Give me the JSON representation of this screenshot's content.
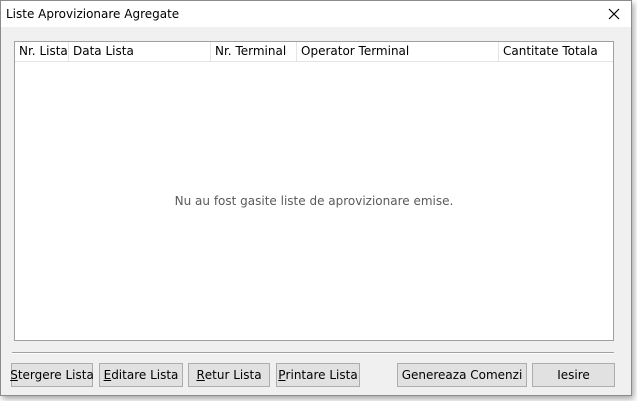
{
  "window": {
    "title": "Liste Aprovizionare Agregate"
  },
  "icons": {
    "close": "close-icon"
  },
  "list": {
    "columns": [
      "Nr. Lista",
      "Data Lista",
      "Nr. Terminal",
      "Operator Terminal",
      "Cantitate Totala"
    ],
    "empty_message": "Nu au fost gasite liste de aprovizionare emise."
  },
  "buttons": {
    "delete": {
      "accel": "S",
      "rest": "tergere Lista"
    },
    "edit": {
      "accel": "E",
      "rest": "ditare Lista"
    },
    "return": {
      "accel": "R",
      "rest": "etur Lista"
    },
    "print": {
      "accel": "P",
      "rest": "rintare Lista"
    },
    "generate": "Genereaza Comenzi",
    "exit": "Iesire"
  }
}
